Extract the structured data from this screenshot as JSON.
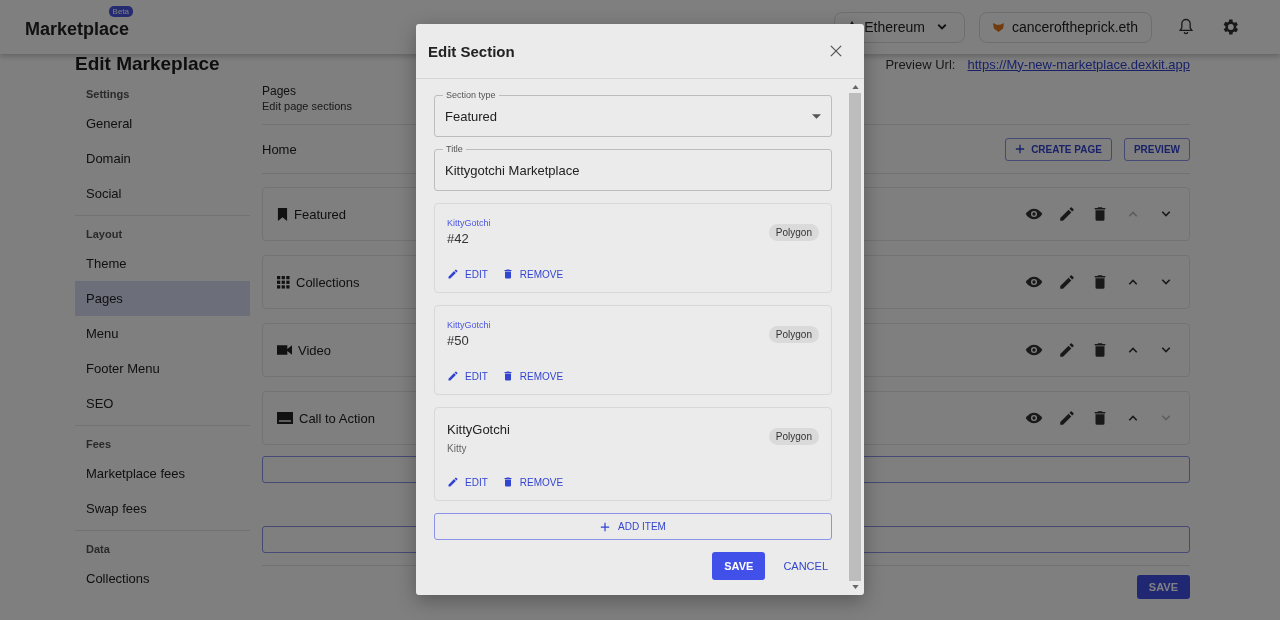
{
  "header": {
    "logo": "Marketplace",
    "logo_badge": "Beta",
    "network": "Ethereum",
    "account": "canceroftheprick.eth"
  },
  "page": {
    "title": "Edit Markeplace",
    "preview_label": "Preview Url:",
    "preview_url": "https://My-new-marketplace.dexkit.app"
  },
  "sidebar": {
    "groups": [
      {
        "title": "Settings",
        "items": [
          {
            "label": "General",
            "selected": false
          },
          {
            "label": "Domain",
            "selected": false
          },
          {
            "label": "Social",
            "selected": false
          }
        ]
      },
      {
        "title": "Layout",
        "items": [
          {
            "label": "Theme",
            "selected": false
          },
          {
            "label": "Pages",
            "selected": true
          },
          {
            "label": "Menu",
            "selected": false
          },
          {
            "label": "Footer Menu",
            "selected": false
          },
          {
            "label": "SEO",
            "selected": false
          }
        ]
      },
      {
        "title": "Fees",
        "items": [
          {
            "label": "Marketplace fees",
            "selected": false
          },
          {
            "label": "Swap fees",
            "selected": false
          }
        ]
      },
      {
        "title": "Data",
        "items": [
          {
            "label": "Collections",
            "selected": false
          }
        ]
      }
    ]
  },
  "main": {
    "heading": "Pages",
    "subheading": "Edit page sections",
    "page_name": "Home",
    "create_button": "CREATE PAGE",
    "preview_button": "PREVIEW",
    "sections": [
      {
        "title": "Featured",
        "kind": "featured",
        "move_up_disabled": true,
        "move_down_disabled": false
      },
      {
        "title": "Collections",
        "kind": "collections",
        "move_up_disabled": false,
        "move_down_disabled": false
      },
      {
        "title": "Video",
        "kind": "video",
        "move_up_disabled": false,
        "move_down_disabled": false
      },
      {
        "title": "Call to Action",
        "kind": "call-to-action",
        "move_up_disabled": false,
        "move_down_disabled": true
      }
    ],
    "save_button": "SAVE"
  },
  "dialog": {
    "title": "Edit Section",
    "fields": [
      {
        "kind": "select",
        "label": "Section type",
        "value": "Featured"
      },
      {
        "kind": "text",
        "label": "Title",
        "value": "Kittygotchi Marketplace"
      }
    ],
    "items": [
      {
        "kind": "asset",
        "collection": "KittyGotchi",
        "name": "#42",
        "network": "Polygon",
        "edit": "EDIT",
        "remove": "REMOVE"
      },
      {
        "kind": "asset",
        "collection": "KittyGotchi",
        "name": "#50",
        "network": "Polygon",
        "edit": "EDIT",
        "remove": "REMOVE"
      },
      {
        "kind": "collection",
        "name": "KittyGotchi",
        "subtitle": "Kitty",
        "network": "Polygon",
        "edit": "EDIT",
        "remove": "REMOVE"
      }
    ],
    "add_button": "ADD ITEM",
    "save_button": "SAVE",
    "cancel_button": "CANCEL"
  }
}
